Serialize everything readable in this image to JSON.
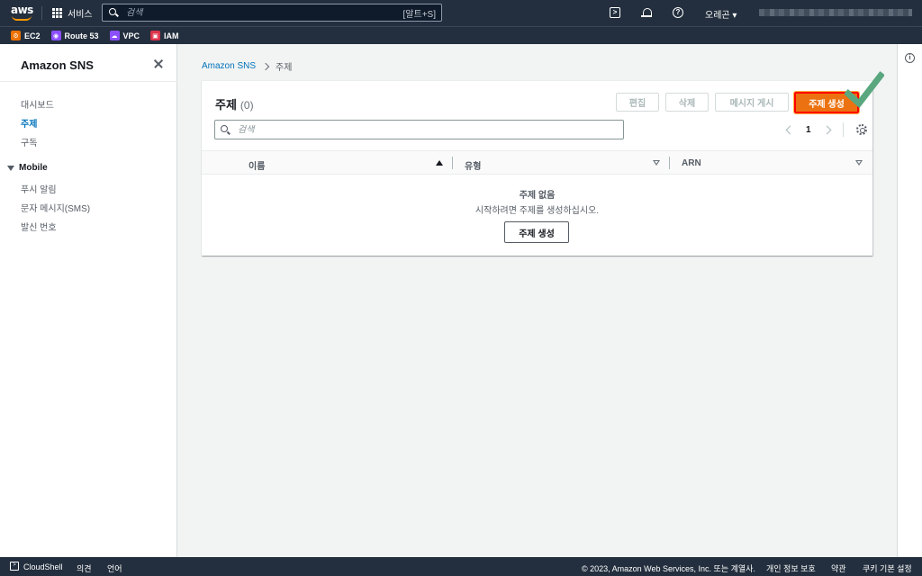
{
  "topnav": {
    "logo_text": "aws",
    "services_label": "서비스",
    "search_placeholder": "검색",
    "search_shortcut": "[알트+S]",
    "region_label": "오레곤 ▾"
  },
  "favorites": [
    {
      "label": "EC2",
      "color": "#ed7100",
      "icon": "ec2-icon"
    },
    {
      "label": "Route 53",
      "color": "#8c4fff",
      "icon": "route53-icon"
    },
    {
      "label": "VPC",
      "color": "#8c4fff",
      "icon": "vpc-icon"
    },
    {
      "label": "IAM",
      "color": "#dd344c",
      "icon": "iam-icon"
    }
  ],
  "sidebar": {
    "title": "Amazon SNS",
    "items": [
      {
        "label": "대시보드"
      },
      {
        "label": "주제"
      },
      {
        "label": "구독"
      }
    ],
    "section_label": "Mobile",
    "section_items": [
      {
        "label": "푸시 알림"
      },
      {
        "label": "문자 메시지(SMS)"
      },
      {
        "label": "발신 번호"
      }
    ]
  },
  "breadcrumb": {
    "root": "Amazon SNS",
    "current": "주제"
  },
  "panel": {
    "title": "주제",
    "count": "(0)",
    "buttons": {
      "edit": "편집",
      "delete": "삭제",
      "publish": "메시지 게시",
      "create": "주제 생성"
    },
    "search_placeholder": "검색",
    "page": "1",
    "columns": [
      "이름",
      "유형",
      "ARN"
    ],
    "empty_title": "주제 없음",
    "empty_desc": "시작하려면 주제를 생성하십시오.",
    "empty_button": "주제 생성"
  },
  "footer": {
    "cloudshell": "CloudShell",
    "feedback": "의견",
    "language": "언어",
    "copyright": "© 2023, Amazon Web Services, Inc. 또는 계열사.",
    "privacy": "개인 정보 보호",
    "terms": "약관",
    "cookies": "쿠키 기본 설정"
  },
  "colors": {
    "nav_bg": "#232f3e",
    "primary": "#ec7211",
    "link": "#0073bb",
    "highlight": "#ff0000",
    "check": "#5aa77f"
  }
}
